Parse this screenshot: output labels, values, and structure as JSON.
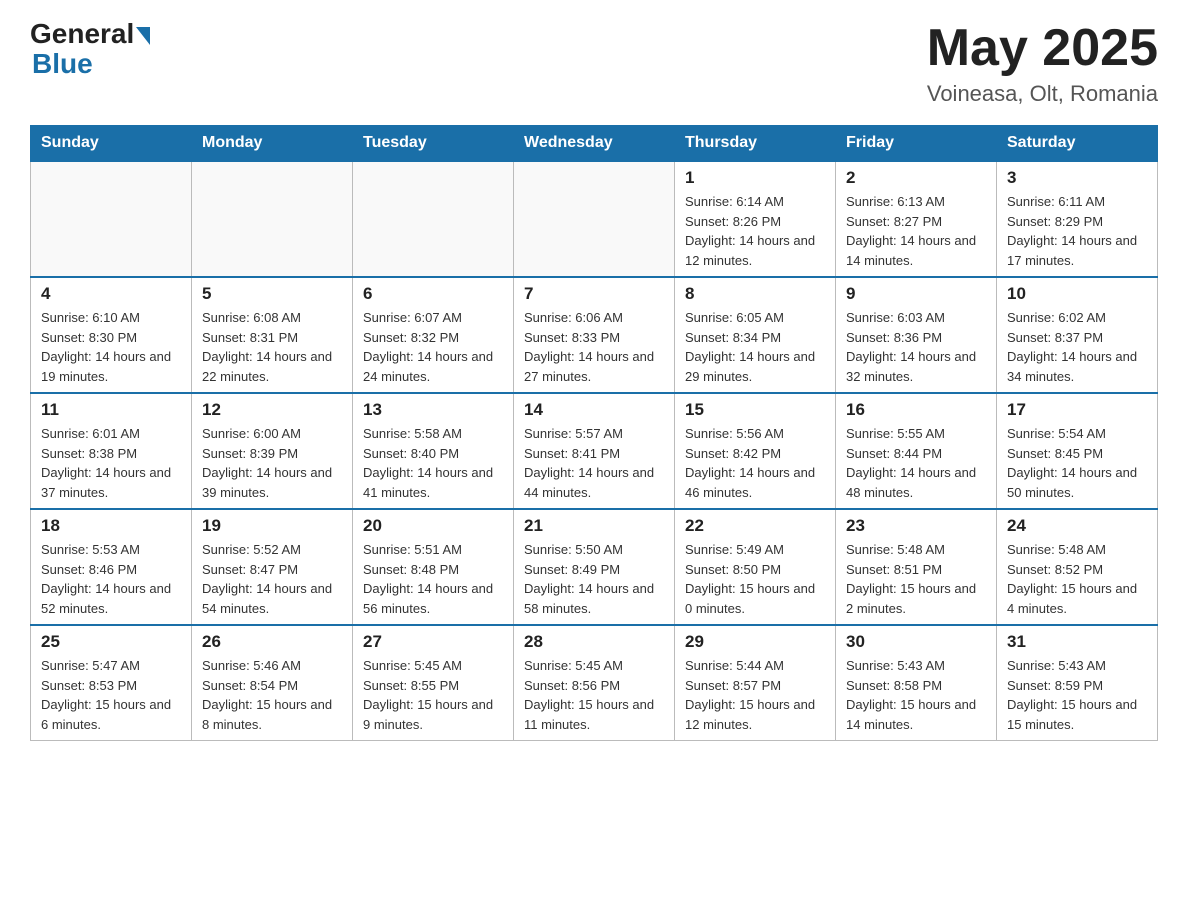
{
  "header": {
    "logo_general": "General",
    "logo_blue": "Blue",
    "title": "May 2025",
    "subtitle": "Voineasa, Olt, Romania"
  },
  "days_of_week": [
    "Sunday",
    "Monday",
    "Tuesday",
    "Wednesday",
    "Thursday",
    "Friday",
    "Saturday"
  ],
  "weeks": [
    [
      {
        "day": "",
        "info": ""
      },
      {
        "day": "",
        "info": ""
      },
      {
        "day": "",
        "info": ""
      },
      {
        "day": "",
        "info": ""
      },
      {
        "day": "1",
        "info": "Sunrise: 6:14 AM\nSunset: 8:26 PM\nDaylight: 14 hours and 12 minutes."
      },
      {
        "day": "2",
        "info": "Sunrise: 6:13 AM\nSunset: 8:27 PM\nDaylight: 14 hours and 14 minutes."
      },
      {
        "day": "3",
        "info": "Sunrise: 6:11 AM\nSunset: 8:29 PM\nDaylight: 14 hours and 17 minutes."
      }
    ],
    [
      {
        "day": "4",
        "info": "Sunrise: 6:10 AM\nSunset: 8:30 PM\nDaylight: 14 hours and 19 minutes."
      },
      {
        "day": "5",
        "info": "Sunrise: 6:08 AM\nSunset: 8:31 PM\nDaylight: 14 hours and 22 minutes."
      },
      {
        "day": "6",
        "info": "Sunrise: 6:07 AM\nSunset: 8:32 PM\nDaylight: 14 hours and 24 minutes."
      },
      {
        "day": "7",
        "info": "Sunrise: 6:06 AM\nSunset: 8:33 PM\nDaylight: 14 hours and 27 minutes."
      },
      {
        "day": "8",
        "info": "Sunrise: 6:05 AM\nSunset: 8:34 PM\nDaylight: 14 hours and 29 minutes."
      },
      {
        "day": "9",
        "info": "Sunrise: 6:03 AM\nSunset: 8:36 PM\nDaylight: 14 hours and 32 minutes."
      },
      {
        "day": "10",
        "info": "Sunrise: 6:02 AM\nSunset: 8:37 PM\nDaylight: 14 hours and 34 minutes."
      }
    ],
    [
      {
        "day": "11",
        "info": "Sunrise: 6:01 AM\nSunset: 8:38 PM\nDaylight: 14 hours and 37 minutes."
      },
      {
        "day": "12",
        "info": "Sunrise: 6:00 AM\nSunset: 8:39 PM\nDaylight: 14 hours and 39 minutes."
      },
      {
        "day": "13",
        "info": "Sunrise: 5:58 AM\nSunset: 8:40 PM\nDaylight: 14 hours and 41 minutes."
      },
      {
        "day": "14",
        "info": "Sunrise: 5:57 AM\nSunset: 8:41 PM\nDaylight: 14 hours and 44 minutes."
      },
      {
        "day": "15",
        "info": "Sunrise: 5:56 AM\nSunset: 8:42 PM\nDaylight: 14 hours and 46 minutes."
      },
      {
        "day": "16",
        "info": "Sunrise: 5:55 AM\nSunset: 8:44 PM\nDaylight: 14 hours and 48 minutes."
      },
      {
        "day": "17",
        "info": "Sunrise: 5:54 AM\nSunset: 8:45 PM\nDaylight: 14 hours and 50 minutes."
      }
    ],
    [
      {
        "day": "18",
        "info": "Sunrise: 5:53 AM\nSunset: 8:46 PM\nDaylight: 14 hours and 52 minutes."
      },
      {
        "day": "19",
        "info": "Sunrise: 5:52 AM\nSunset: 8:47 PM\nDaylight: 14 hours and 54 minutes."
      },
      {
        "day": "20",
        "info": "Sunrise: 5:51 AM\nSunset: 8:48 PM\nDaylight: 14 hours and 56 minutes."
      },
      {
        "day": "21",
        "info": "Sunrise: 5:50 AM\nSunset: 8:49 PM\nDaylight: 14 hours and 58 minutes."
      },
      {
        "day": "22",
        "info": "Sunrise: 5:49 AM\nSunset: 8:50 PM\nDaylight: 15 hours and 0 minutes."
      },
      {
        "day": "23",
        "info": "Sunrise: 5:48 AM\nSunset: 8:51 PM\nDaylight: 15 hours and 2 minutes."
      },
      {
        "day": "24",
        "info": "Sunrise: 5:48 AM\nSunset: 8:52 PM\nDaylight: 15 hours and 4 minutes."
      }
    ],
    [
      {
        "day": "25",
        "info": "Sunrise: 5:47 AM\nSunset: 8:53 PM\nDaylight: 15 hours and 6 minutes."
      },
      {
        "day": "26",
        "info": "Sunrise: 5:46 AM\nSunset: 8:54 PM\nDaylight: 15 hours and 8 minutes."
      },
      {
        "day": "27",
        "info": "Sunrise: 5:45 AM\nSunset: 8:55 PM\nDaylight: 15 hours and 9 minutes."
      },
      {
        "day": "28",
        "info": "Sunrise: 5:45 AM\nSunset: 8:56 PM\nDaylight: 15 hours and 11 minutes."
      },
      {
        "day": "29",
        "info": "Sunrise: 5:44 AM\nSunset: 8:57 PM\nDaylight: 15 hours and 12 minutes."
      },
      {
        "day": "30",
        "info": "Sunrise: 5:43 AM\nSunset: 8:58 PM\nDaylight: 15 hours and 14 minutes."
      },
      {
        "day": "31",
        "info": "Sunrise: 5:43 AM\nSunset: 8:59 PM\nDaylight: 15 hours and 15 minutes."
      }
    ]
  ]
}
